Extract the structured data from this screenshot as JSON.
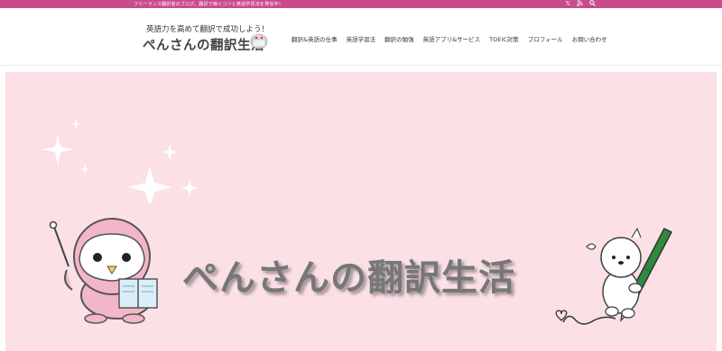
{
  "topbar": {
    "text": "フリーランス翻訳者のブログ。翻訳で稼ぐコツと英語学習法を発信中！",
    "icons": [
      "x-icon",
      "rss-icon",
      "search-icon"
    ]
  },
  "header": {
    "logo_tagline": "英語力を高めて翻訳で成功しよう！",
    "logo_title": "ぺんさんの翻訳生活",
    "nav": [
      "翻訳&英語の仕事",
      "英語学習法",
      "翻訳の勉強",
      "英語アプリ&サービス",
      "TOEIC対策",
      "プロフィール",
      "お問い合わせ"
    ]
  },
  "hero": {
    "title": "ぺんさんの翻訳生活"
  },
  "colors": {
    "topbar": "#c94b8d",
    "hero_bg": "#fbe0e6",
    "penguin_pink": "#f3b6c8",
    "pencil_green": "#2e8b3e"
  }
}
